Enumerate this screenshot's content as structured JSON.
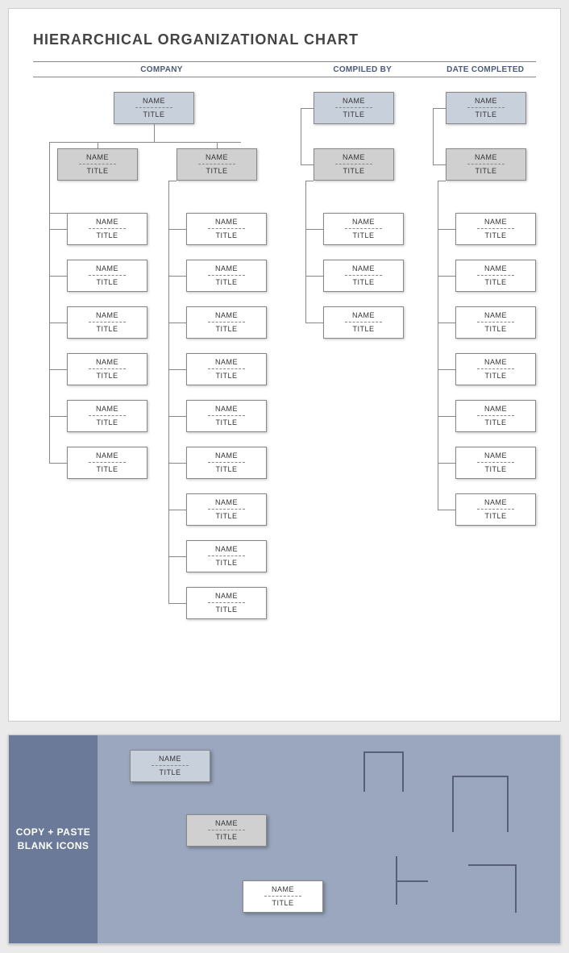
{
  "title": "HIERARCHICAL ORGANIZATIONAL CHART",
  "headers": {
    "company": "COMPANY",
    "compiled_by": "COMPILED BY",
    "date_completed": "DATE COMPLETED"
  },
  "node_text": {
    "name": "NAME",
    "title": "TITLE"
  },
  "chart_data": {
    "type": "hierarchy",
    "groups": [
      {
        "root": {
          "name": "NAME",
          "title": "TITLE"
        },
        "branches": [
          {
            "head": {
              "name": "NAME",
              "title": "TITLE"
            },
            "children": [
              {
                "name": "NAME",
                "title": "TITLE"
              },
              {
                "name": "NAME",
                "title": "TITLE"
              },
              {
                "name": "NAME",
                "title": "TITLE"
              },
              {
                "name": "NAME",
                "title": "TITLE"
              },
              {
                "name": "NAME",
                "title": "TITLE"
              },
              {
                "name": "NAME",
                "title": "TITLE"
              }
            ]
          },
          {
            "head": {
              "name": "NAME",
              "title": "TITLE"
            },
            "children": [
              {
                "name": "NAME",
                "title": "TITLE"
              },
              {
                "name": "NAME",
                "title": "TITLE"
              },
              {
                "name": "NAME",
                "title": "TITLE"
              },
              {
                "name": "NAME",
                "title": "TITLE"
              },
              {
                "name": "NAME",
                "title": "TITLE"
              },
              {
                "name": "NAME",
                "title": "TITLE"
              },
              {
                "name": "NAME",
                "title": "TITLE"
              },
              {
                "name": "NAME",
                "title": "TITLE"
              },
              {
                "name": "NAME",
                "title": "TITLE"
              }
            ]
          }
        ]
      },
      {
        "root": {
          "name": "NAME",
          "title": "TITLE"
        },
        "branches": [
          {
            "head": {
              "name": "NAME",
              "title": "TITLE"
            },
            "children": [
              {
                "name": "NAME",
                "title": "TITLE"
              },
              {
                "name": "NAME",
                "title": "TITLE"
              },
              {
                "name": "NAME",
                "title": "TITLE"
              }
            ]
          }
        ]
      },
      {
        "root": {
          "name": "NAME",
          "title": "TITLE"
        },
        "branches": [
          {
            "head": {
              "name": "NAME",
              "title": "TITLE"
            },
            "children": [
              {
                "name": "NAME",
                "title": "TITLE"
              },
              {
                "name": "NAME",
                "title": "TITLE"
              },
              {
                "name": "NAME",
                "title": "TITLE"
              },
              {
                "name": "NAME",
                "title": "TITLE"
              },
              {
                "name": "NAME",
                "title": "TITLE"
              },
              {
                "name": "NAME",
                "title": "TITLE"
              },
              {
                "name": "NAME",
                "title": "TITLE"
              }
            ]
          }
        ]
      }
    ]
  },
  "panel": {
    "label_line1": "COPY + PASTE",
    "label_line2": "BLANK ICONS",
    "samples": [
      {
        "name": "NAME",
        "title": "TITLE"
      },
      {
        "name": "NAME",
        "title": "TITLE"
      },
      {
        "name": "NAME",
        "title": "TITLE"
      }
    ]
  }
}
